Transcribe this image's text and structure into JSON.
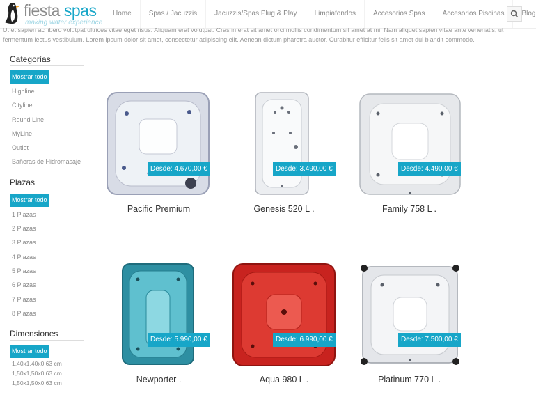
{
  "brand": {
    "name_part1": "fiesta",
    "name_part2": "spas",
    "tagline": "making water experience",
    "logo_icon": "penguin-logo-icon"
  },
  "nav": {
    "items": [
      "Home",
      "Spas / Jacuzzis",
      "Jacuzzis/Spas Plug & Play",
      "Limpiafondos",
      "Accesorios Spas",
      "Accesorios Piscinas",
      "Blog"
    ],
    "search_icon": "search-icon"
  },
  "intro": {
    "text": "Ut et sapien ac libero volutpat ultrices vitae eget risus. Aliquam erat volutpat. Cras in erat sit amet orci mollis condimentum sit amet at mi. Nam aliquet sapien vitae ante venenatis, ut fermentum lectus vestibulum. Lorem ipsum dolor sit amet, consectetur adipiscing elit. Aenean dictum pharetra auctor. Curabitur efficitur felis sit amet dui blandit commodo."
  },
  "sidebar": {
    "categorias": {
      "title": "Categorías",
      "show_all": "Mostrar todo",
      "items": [
        "Highline",
        "Cityline",
        "Round Line",
        "MyLine",
        "Outlet",
        "Bañeras de Hidromasaje"
      ]
    },
    "plazas": {
      "title": "Plazas",
      "show_all": "Mostrar todo",
      "items": [
        "1 Plazas",
        "2 Plazas",
        "3 Plazas",
        "4 Plazas",
        "5 Plazas",
        "6 Plazas",
        "7 Plazas",
        "8 Plazas"
      ]
    },
    "dimensiones": {
      "title": "Dimensiones",
      "show_all": "Mostrar todo",
      "items": [
        "1,40x1,40x0,63 cm",
        "1,50x1,50x0,63 cm",
        "1,50x1,50x0,63 cm"
      ]
    }
  },
  "products": [
    {
      "name": "Pacific Premium",
      "price": "Desde: 4.670,00 €",
      "color": "#e7ebf2"
    },
    {
      "name": "Genesis 520 L .",
      "price": "Desde: 3.490,00 €",
      "color": "#eef0f2"
    },
    {
      "name": "Family 758 L .",
      "price": "Desde: 4.490,00 €",
      "color": "#eceff1"
    },
    {
      "name": "Newporter .",
      "price": "Desde: 5.990,00 €",
      "color": "#3a9fb0"
    },
    {
      "name": "Aqua 980 L .",
      "price": "Desde: 6.990,00 €",
      "color": "#c8231f"
    },
    {
      "name": "Platinum 770 L .",
      "price": "Desde: 7.500,00 €",
      "color": "#e9ebee"
    }
  ],
  "colors": {
    "accent": "#17a6c8",
    "muted_text": "#8a8a8a"
  }
}
